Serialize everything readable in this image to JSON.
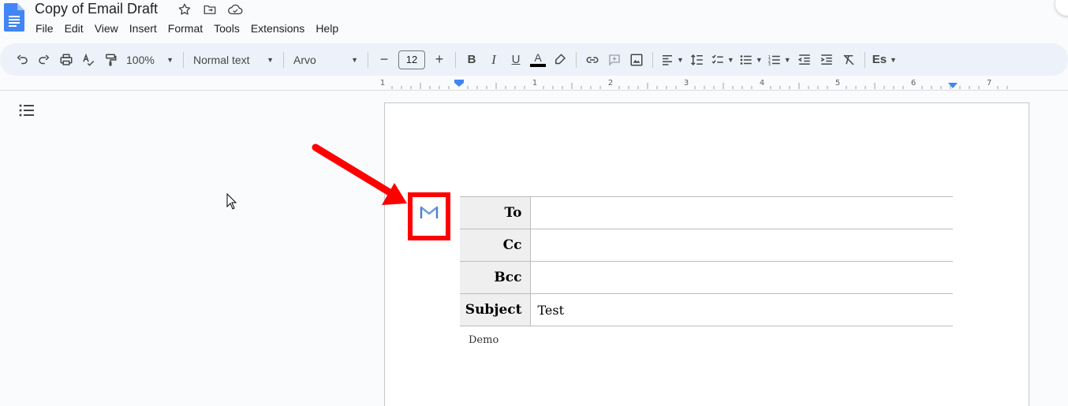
{
  "app": {
    "title": "Copy of Email Draft"
  },
  "menu": [
    "File",
    "Edit",
    "View",
    "Insert",
    "Format",
    "Tools",
    "Extensions",
    "Help"
  ],
  "toolbar": {
    "zoom": "100%",
    "style": "Normal text",
    "font": "Arvo",
    "font_size": "12",
    "minus": "−",
    "plus": "+",
    "bold": "B",
    "italic": "I",
    "underline": "U",
    "text_color_letter": "A",
    "input_tools": "Es"
  },
  "ruler": {
    "labels": [
      "1",
      "1",
      "2",
      "3",
      "4",
      "5",
      "6",
      "7"
    ]
  },
  "email_draft": {
    "rows": [
      {
        "label": "To",
        "value": ""
      },
      {
        "label": "Cc",
        "value": ""
      },
      {
        "label": "Bcc",
        "value": ""
      },
      {
        "label": "Subject",
        "value": "Test"
      }
    ],
    "body": "Demo"
  },
  "colors": {
    "accent": "#0b57d0",
    "highlight": "#ff0000",
    "toolbar_bg": "#edf2fa",
    "doc_icon": "#4285f4"
  },
  "icons": {
    "doc": "google-docs-icon",
    "star": "star-icon",
    "move": "move-to-folder-icon",
    "cloud": "cloud-status-icon",
    "outline": "document-outline-icon",
    "gmail": "gmail-draft-icon"
  }
}
